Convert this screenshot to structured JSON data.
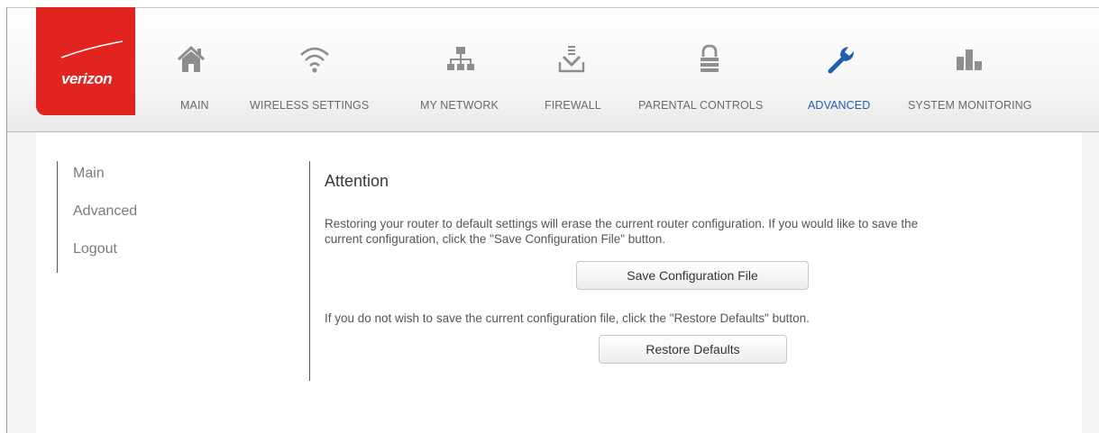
{
  "brand": {
    "logo_text": "verizon",
    "accent": "#e1241f"
  },
  "nav": {
    "items": [
      {
        "label": "MAIN",
        "icon": "home-icon"
      },
      {
        "label": "WIRELESS SETTINGS",
        "icon": "wifi-icon"
      },
      {
        "label": "MY NETWORK",
        "icon": "network-icon"
      },
      {
        "label": "FIREWALL",
        "icon": "firewall-icon"
      },
      {
        "label": "PARENTAL CONTROLS",
        "icon": "lock-icon"
      },
      {
        "label": "ADVANCED",
        "icon": "wrench-icon",
        "active": true
      },
      {
        "label": "SYSTEM MONITORING",
        "icon": "bar-chart-icon"
      }
    ],
    "active_color": "#1f5fae"
  },
  "sidebar": {
    "items": [
      {
        "label": "Main"
      },
      {
        "label": "Advanced"
      },
      {
        "label": "Logout"
      }
    ]
  },
  "main": {
    "title": "Attention",
    "paragraph1_line1": "Restoring your router to default settings will erase the current router configuration. If you would like to save the",
    "paragraph1_line2": "current configuration, click the \"Save Configuration File\" button.",
    "save_button": "Save Configuration File",
    "paragraph2": "If you do not wish to save the current configuration file, click the \"Restore Defaults\" button.",
    "restore_button": "Restore Defaults"
  }
}
